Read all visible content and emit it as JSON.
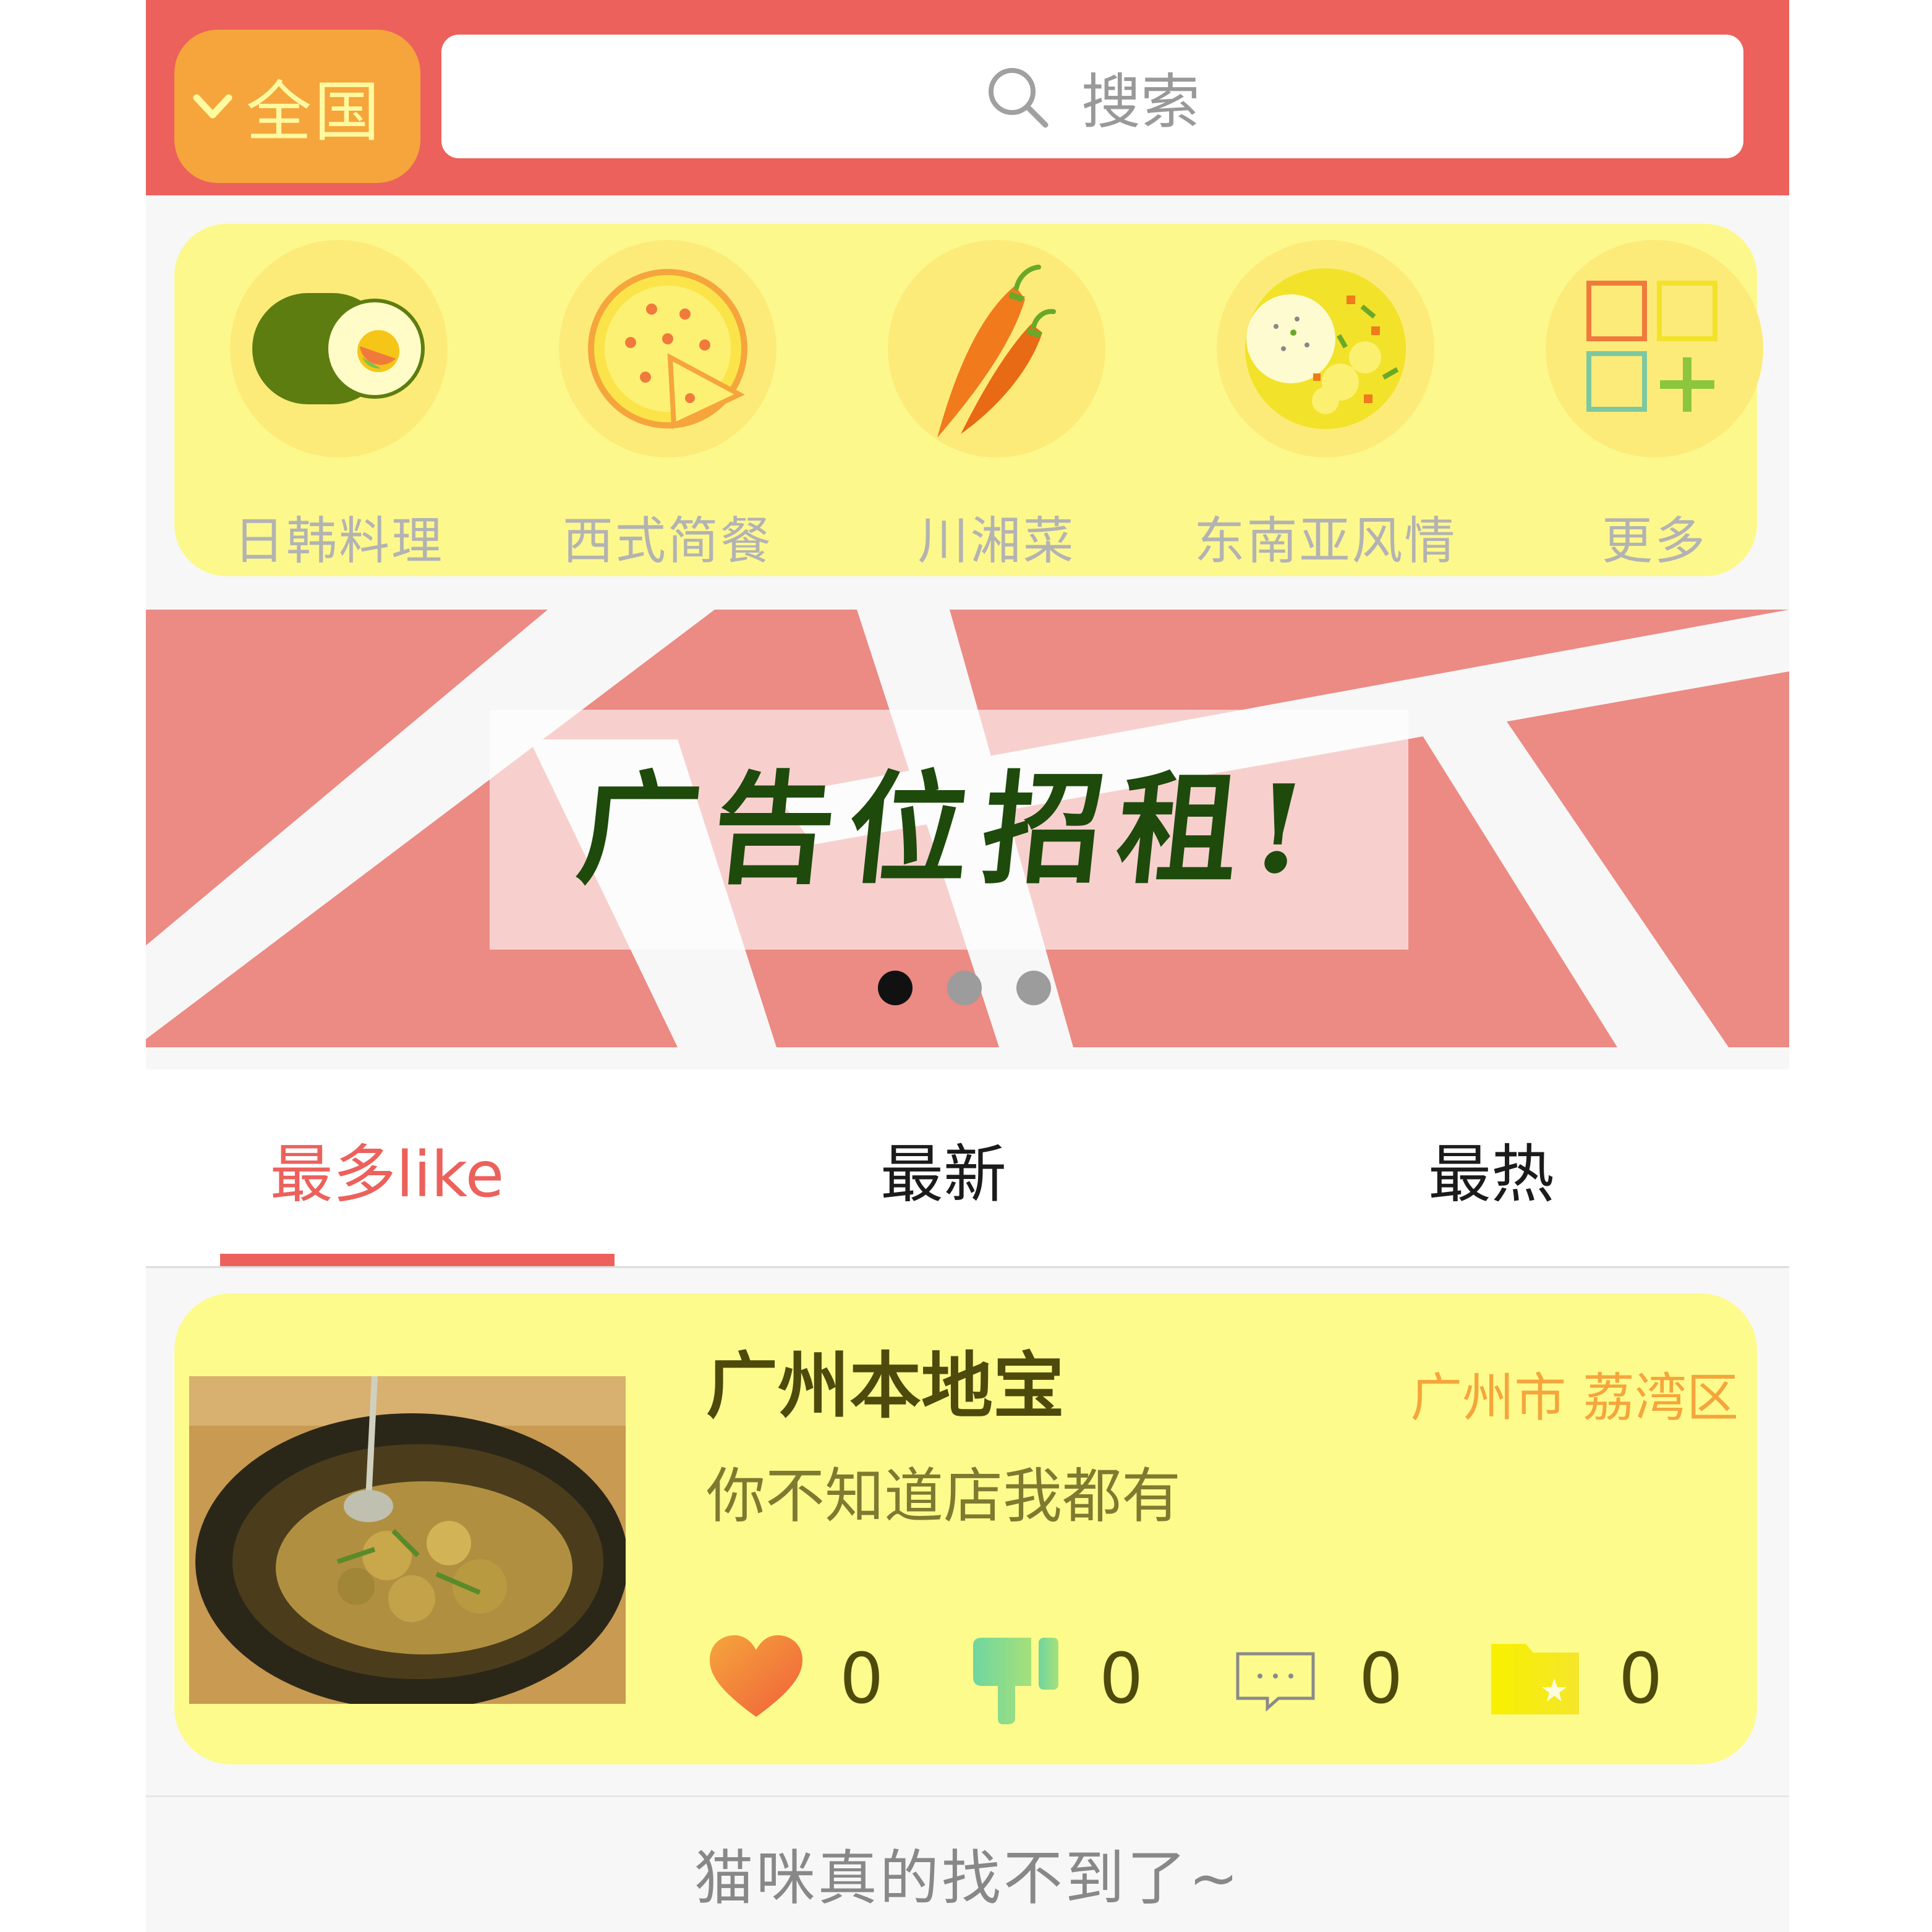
{
  "header": {
    "city_label": "全国",
    "search_placeholder": "搜索"
  },
  "categories": [
    {
      "label": "日韩料理",
      "icon": "sushi-icon"
    },
    {
      "label": "西式简餐",
      "icon": "pizza-icon"
    },
    {
      "label": "川湘菜",
      "icon": "chili-icon"
    },
    {
      "label": "东南亚风情",
      "icon": "curry-rice-icon"
    },
    {
      "label": "更多",
      "icon": "more-grid-icon"
    }
  ],
  "banner": {
    "text": "广告位招租!",
    "dots": 3,
    "active_dot": 0
  },
  "tabs": [
    {
      "label": "最多like",
      "active": true
    },
    {
      "label": "最新",
      "active": false
    },
    {
      "label": "最热",
      "active": false
    }
  ],
  "listing": {
    "title": "广州本地宝",
    "location": "广州市 荔湾区",
    "description": "你不知道店我都有",
    "likes": "0",
    "dislikes": "0",
    "comments": "0",
    "favorites": "0"
  },
  "footer": {
    "message": "猫咪真的找不到了~"
  },
  "colors": {
    "header_red": "#ec615b",
    "city_orange": "#f5a53c",
    "panel_yellow": "#fdf88c",
    "banner_pink": "#ec8a84",
    "tab_active": "#ec615b"
  }
}
